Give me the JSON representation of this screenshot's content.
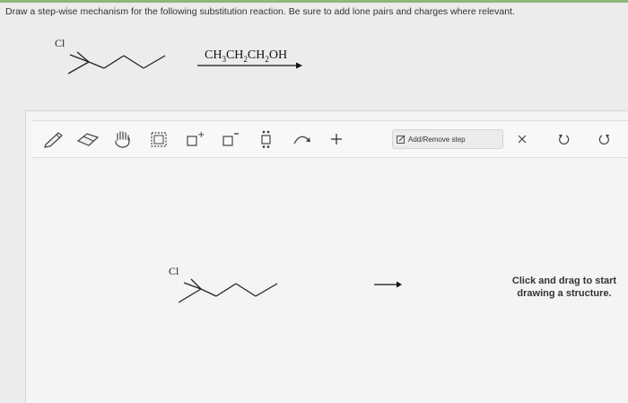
{
  "question": {
    "text": "Draw a step-wise mechanism for the following substitution reaction. Be sure to add lone pairs and charges where relevant."
  },
  "reaction": {
    "substituent_label": "Cl",
    "reagent": {
      "p1": "CH",
      "s1": "3",
      "p2": "CH",
      "s2": "2",
      "p3": "CH",
      "s3": "2",
      "p4": "OH"
    }
  },
  "toolbar": {
    "tools": [
      {
        "name": "pencil-icon"
      },
      {
        "name": "eraser-icon"
      },
      {
        "name": "hand-icon"
      },
      {
        "name": "select-box-icon"
      },
      {
        "name": "positive-charge-icon"
      },
      {
        "name": "negative-charge-icon"
      },
      {
        "name": "lone-pair-icon"
      },
      {
        "name": "curved-arrow-icon"
      },
      {
        "name": "plus-icon"
      }
    ],
    "add_remove_label": "Add/Remove step",
    "controls": [
      "close-icon",
      "undo-icon",
      "redo-icon"
    ]
  },
  "canvas": {
    "substituent_label": "Cl",
    "hint_line1": "Click and drag to start",
    "hint_line2": "drawing a structure."
  },
  "colors": {
    "accent": "#8fb87a",
    "ink": "#222222"
  }
}
